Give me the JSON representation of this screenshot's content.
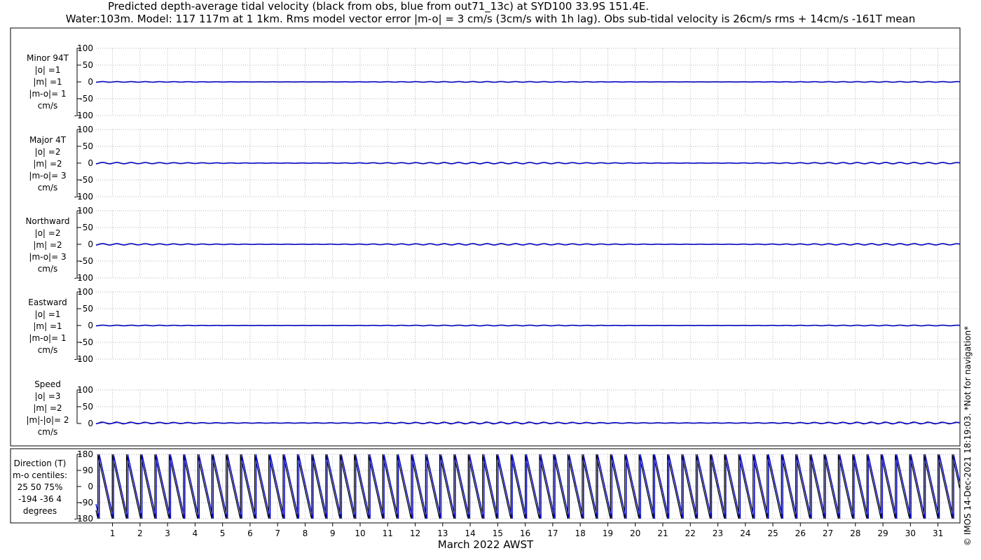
{
  "title_line1": "Predicted depth-average tidal velocity (black from obs, blue from out71_13c) at SYD100 33.9S 151.4E.",
  "title_line2": "Water:103m. Model: 117 117m at 1 1km. Rms model vector error |m-o| = 3 cm/s (3cm/s with 1h lag). Obs sub-tidal velocity is 26cm/s rms + 14cm/s -161T mean",
  "credit": "© IMOS 14-Dec-2021 18:19:03. *Not for navigation*",
  "xlabel": "March 2022 AWST",
  "colors": {
    "obs": "#000000",
    "model": "#0a0ac8",
    "grid": "#9a9a9a"
  },
  "chart_data": [
    {
      "type": "line",
      "name": "Minor 94T",
      "label_lines": [
        "Minor 94T",
        "|o| =1",
        "|m| =1",
        "|m-o|= 1",
        "cm/s"
      ],
      "ylim": [
        -100,
        100
      ],
      "yticks": [
        100,
        50,
        0,
        -50,
        -100
      ],
      "xlim": [
        0.4,
        31.8
      ],
      "amplitude": {
        "obs": 1,
        "model": 1
      }
    },
    {
      "type": "line",
      "name": "Major 4T",
      "label_lines": [
        "Major 4T",
        "|o| =2",
        "|m| =2",
        "|m-o|= 3",
        "cm/s"
      ],
      "ylim": [
        -100,
        100
      ],
      "yticks": [
        100,
        50,
        0,
        -50,
        -100
      ],
      "xlim": [
        0.4,
        31.8
      ],
      "amplitude": {
        "obs": 2,
        "model": 2
      }
    },
    {
      "type": "line",
      "name": "Northward",
      "label_lines": [
        "Northward",
        "|o| =2",
        "|m| =2",
        "|m-o|= 3",
        "cm/s"
      ],
      "ylim": [
        -100,
        100
      ],
      "yticks": [
        100,
        50,
        0,
        -50,
        -100
      ],
      "xlim": [
        0.4,
        31.8
      ],
      "amplitude": {
        "obs": 2,
        "model": 2
      }
    },
    {
      "type": "line",
      "name": "Eastward",
      "label_lines": [
        "Eastward",
        "|o| =1",
        "|m| =1",
        "|m-o|= 1",
        "cm/s"
      ],
      "ylim": [
        -100,
        100
      ],
      "yticks": [
        100,
        50,
        0,
        -50,
        -100
      ],
      "xlim": [
        0.4,
        31.8
      ],
      "amplitude": {
        "obs": 1,
        "model": 1
      }
    },
    {
      "type": "line",
      "name": "Speed",
      "label_lines": [
        "Speed",
        "|o| =3",
        "|m| =2",
        "|m|-|o|= 2",
        "cm/s"
      ],
      "ylim": [
        0,
        100
      ],
      "yticks": [
        100,
        50,
        0
      ],
      "xlim": [
        0.4,
        31.8
      ],
      "amplitude": {
        "obs": 3,
        "model": 2
      }
    },
    {
      "type": "line",
      "name": "Direction (T)",
      "label_lines": [
        "Direction (T)",
        "m-o centiles:",
        "25  50  75%",
        "-194  -36    4",
        "degrees"
      ],
      "ylim": [
        -180,
        180
      ],
      "yticks": [
        180,
        90,
        0,
        -90,
        -180
      ],
      "xlim": [
        0.4,
        31.8
      ]
    }
  ],
  "xticks": [
    1,
    2,
    3,
    4,
    5,
    6,
    7,
    8,
    9,
    10,
    11,
    12,
    13,
    14,
    15,
    16,
    17,
    18,
    19,
    20,
    21,
    22,
    23,
    24,
    25,
    26,
    27,
    28,
    29,
    30,
    31
  ]
}
